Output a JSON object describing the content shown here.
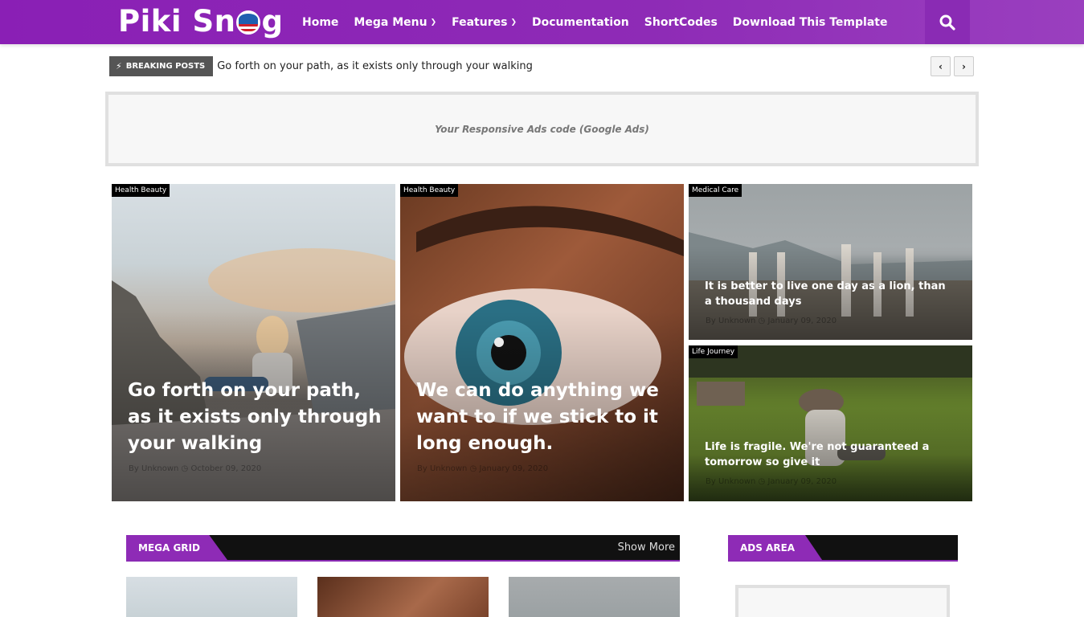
{
  "header": {
    "logo": {
      "part1": "Piki Sn",
      "part2": "g"
    },
    "nav": [
      {
        "label": "Home",
        "dropdown": false
      },
      {
        "label": "Mega Menu",
        "dropdown": true
      },
      {
        "label": "Features",
        "dropdown": true
      },
      {
        "label": "Documentation",
        "dropdown": false
      },
      {
        "label": "ShortCodes",
        "dropdown": false
      },
      {
        "label": "Download This Template",
        "dropdown": false
      }
    ],
    "search_icon": "search-icon",
    "accent_color": "#8a1fb5"
  },
  "breaking": {
    "label": "BREAKING POSTS",
    "text": "Go forth on your path, as it exists only through your walking"
  },
  "ad": {
    "text": "Your Responsive Ads code (Google Ads)"
  },
  "featured": [
    {
      "tag": "Health Beauty",
      "title": "Go forth on your path, as it exists only through your walking",
      "meta": "By Unknown ◷ October 09, 2020"
    },
    {
      "tag": "Health Beauty",
      "title": "We can do anything we want to if we stick to it long enough.",
      "meta": "By Unknown ◷ January 09, 2020"
    },
    {
      "tag": "Medical Care",
      "title": "It is better to live one day as a lion, than a thousand days",
      "meta": "By Unknown ◷ January 09, 2020"
    },
    {
      "tag": "Life Journey",
      "title": "Life is fragile. We're not guaranteed a tomorrow so give it",
      "meta": "By Unknown ◷ January 09, 2020"
    }
  ],
  "sections": {
    "mega_grid": {
      "label": "MEGA GRID",
      "more": "Show More"
    },
    "ads_area": {
      "label": "ADS AREA"
    }
  }
}
